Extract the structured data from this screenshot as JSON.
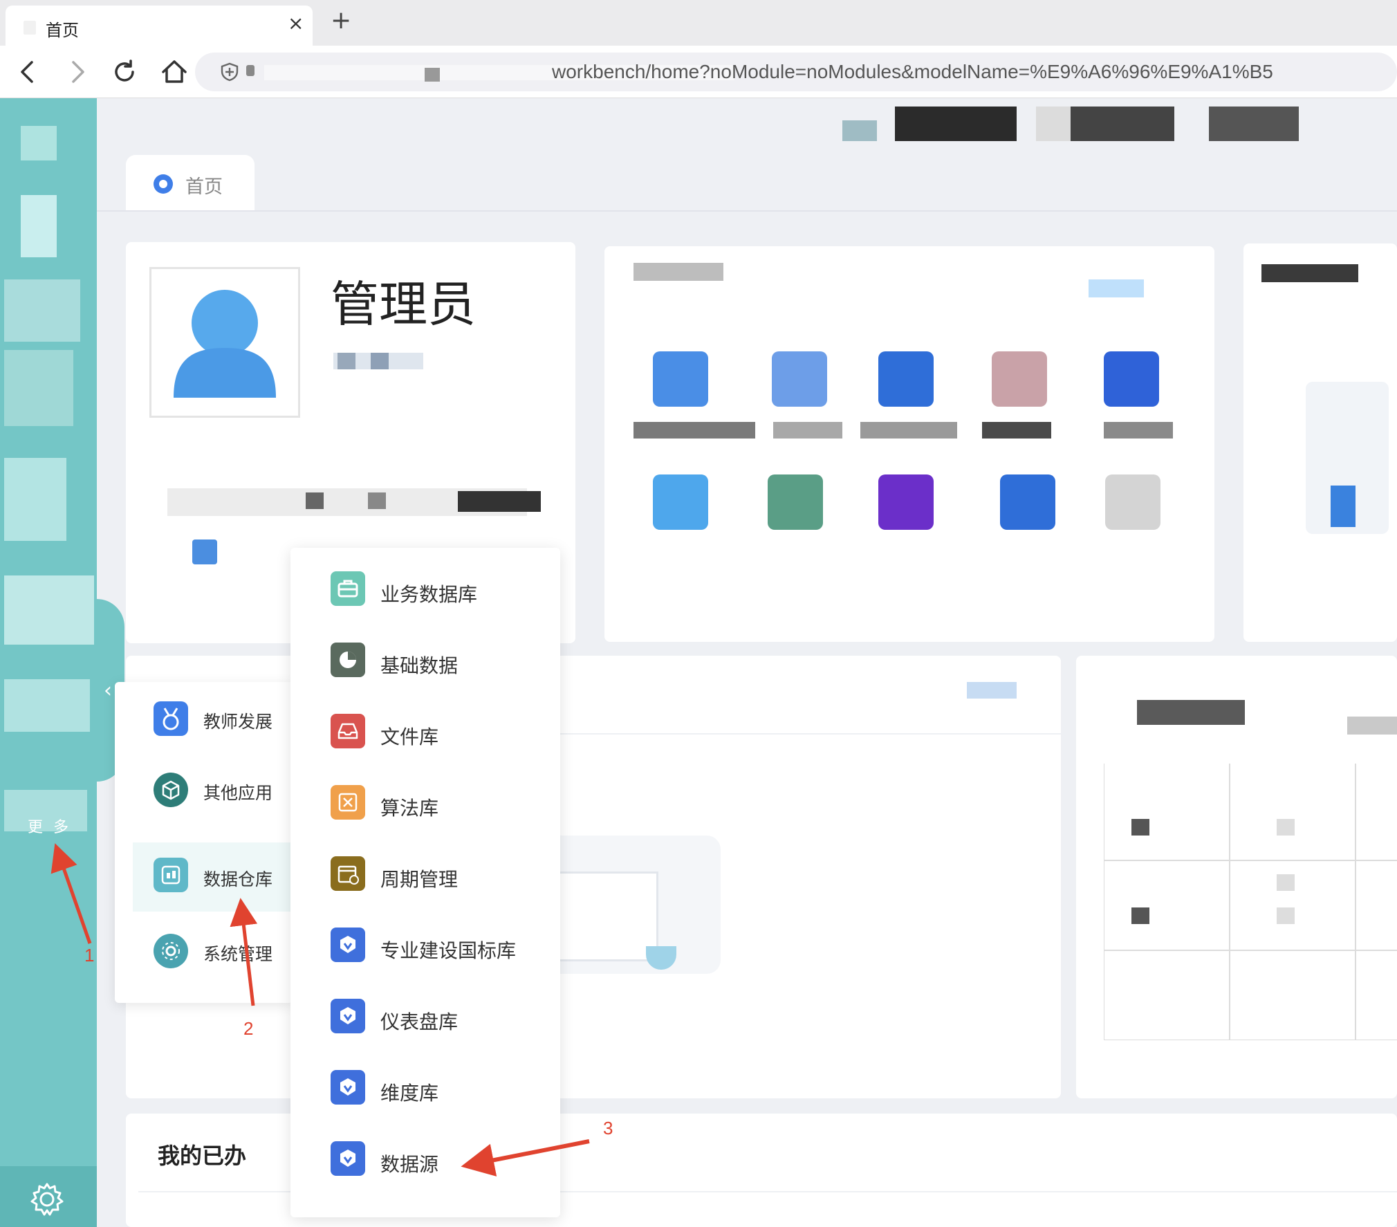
{
  "browser": {
    "tab_title": "首页",
    "url": "workbench/home?noModule=noModules&modelName=%E9%A6%96%E9%A1%B5"
  },
  "sidebar": {
    "more_label": "更 多"
  },
  "page_tab": {
    "label": "首页"
  },
  "profile": {
    "name": "管理员"
  },
  "menu_level1": [
    {
      "label": "教师发展",
      "icon": "medal-icon",
      "color": "#3f7ee8"
    },
    {
      "label": "其他应用",
      "icon": "cube-icon",
      "color": "#2e7d78"
    },
    {
      "label": "数据仓库",
      "icon": "warehouse-icon",
      "color": "#5fb8c8",
      "active": true
    },
    {
      "label": "系统管理",
      "icon": "system-gear-icon",
      "color": "#4aa3b0"
    }
  ],
  "menu_level2": [
    {
      "label": "业务数据库",
      "icon": "briefcase-icon",
      "color": "#6cc7b4"
    },
    {
      "label": "基础数据",
      "icon": "pie-icon",
      "color": "#5a6a5e"
    },
    {
      "label": "文件库",
      "icon": "tray-icon",
      "color": "#d9534f"
    },
    {
      "label": "算法库",
      "icon": "algorithm-icon",
      "color": "#f0a04b"
    },
    {
      "label": "周期管理",
      "icon": "calendar-icon",
      "color": "#8a6d1e"
    },
    {
      "label": "专业建设国标库",
      "icon": "badge-icon",
      "color": "#3f6fdc"
    },
    {
      "label": "仪表盘库",
      "icon": "badge-icon",
      "color": "#3f6fdc"
    },
    {
      "label": "维度库",
      "icon": "badge-icon",
      "color": "#3f6fdc"
    },
    {
      "label": "数据源",
      "icon": "badge-icon",
      "color": "#3f6fdc"
    }
  ],
  "done_section": {
    "title": "我的已办"
  },
  "annotations": [
    "1",
    "2",
    "3"
  ],
  "accent_color": "#74c6c6"
}
